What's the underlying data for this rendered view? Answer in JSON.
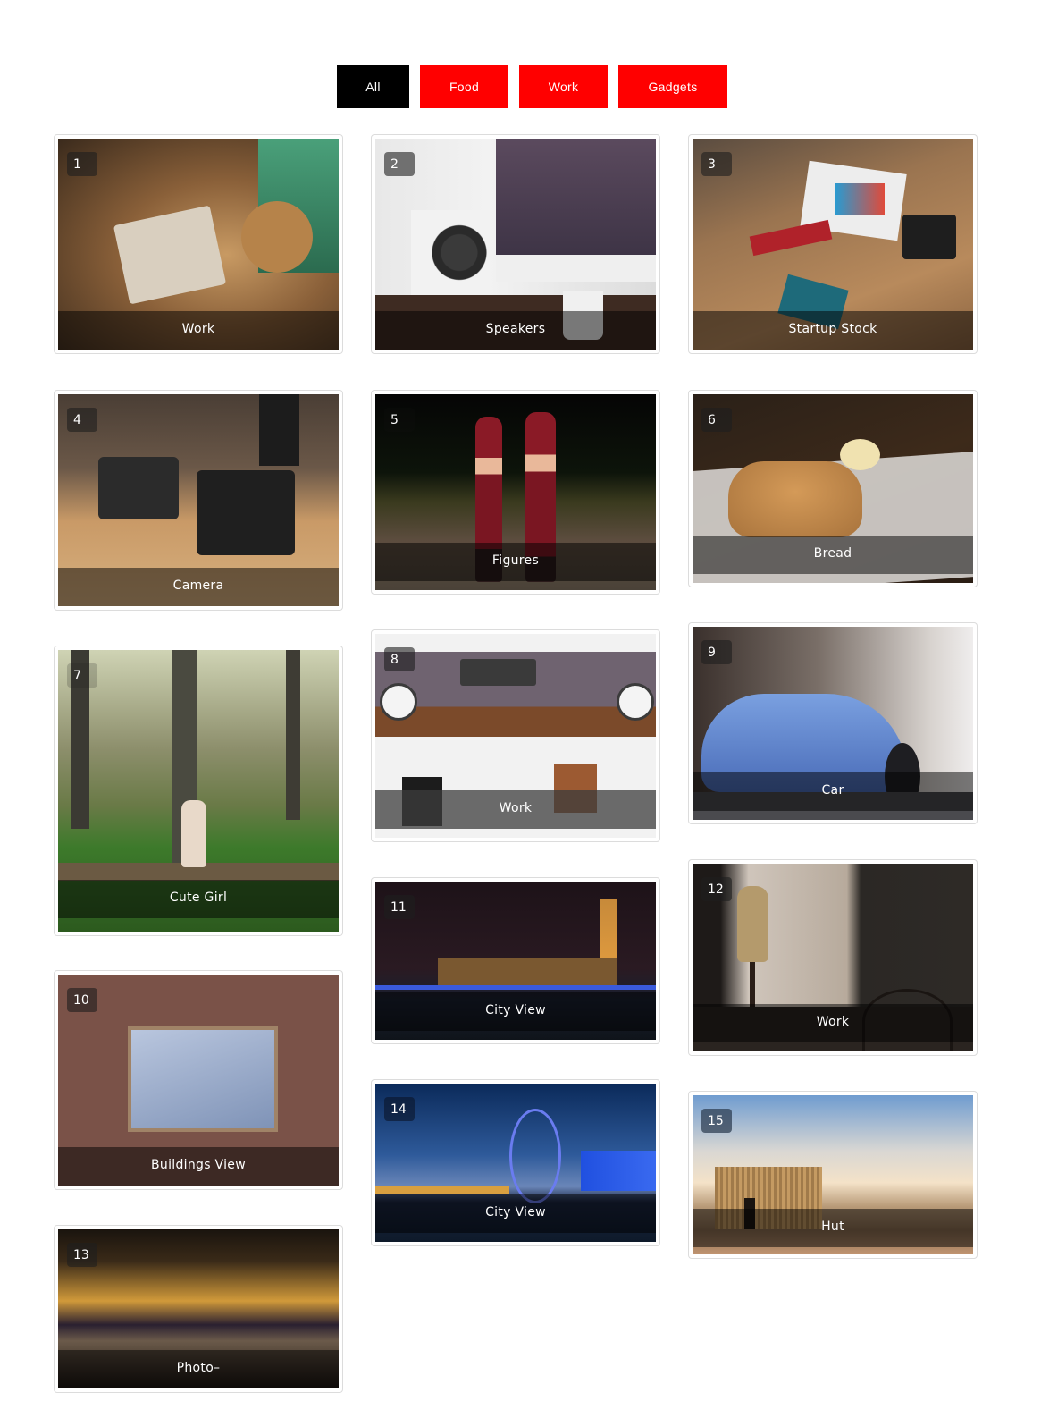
{
  "filters": [
    {
      "label": "All",
      "active": true
    },
    {
      "label": "Food",
      "active": false
    },
    {
      "label": "Work",
      "active": false
    },
    {
      "label": "Gadgets",
      "active": false
    }
  ],
  "colors": {
    "filter_active_bg": "#000000",
    "filter_bg": "#ff0000"
  },
  "gallery": [
    {
      "number": "1",
      "caption": "Work",
      "subject": "desk with notebooks and coasters"
    },
    {
      "number": "2",
      "caption": "Speakers",
      "subject": "white speaker on desk with monitor"
    },
    {
      "number": "3",
      "caption": "Startup Stock",
      "subject": "flat-lay of items on wooden table"
    },
    {
      "number": "4",
      "caption": "Camera",
      "subject": "vintage cameras on shelf"
    },
    {
      "number": "5",
      "caption": "Figures",
      "subject": "two gnome figurines"
    },
    {
      "number": "6",
      "caption": "Bread",
      "subject": "loaf of bread on cloth"
    },
    {
      "number": "7",
      "caption": "Cute Girl",
      "subject": "girl sitting on log in forest"
    },
    {
      "number": "8",
      "caption": "Work",
      "subject": "top-down desk with keyboard and speakers"
    },
    {
      "number": "9",
      "caption": "Car",
      "subject": "blue car on city street"
    },
    {
      "number": "10",
      "caption": "Buildings View",
      "subject": "courtyard looking up at sky"
    },
    {
      "number": "11",
      "caption": "City View",
      "subject": "Westminster and Big Ben at night"
    },
    {
      "number": "12",
      "caption": "Work",
      "subject": "mannequin by cafe window"
    },
    {
      "number": "13",
      "caption": "Photo–",
      "subject": "arches with city skyline at dusk"
    },
    {
      "number": "14",
      "caption": "City View",
      "subject": "London Eye at dusk"
    },
    {
      "number": "15",
      "caption": "Hut",
      "subject": "straw hut in desert"
    }
  ]
}
